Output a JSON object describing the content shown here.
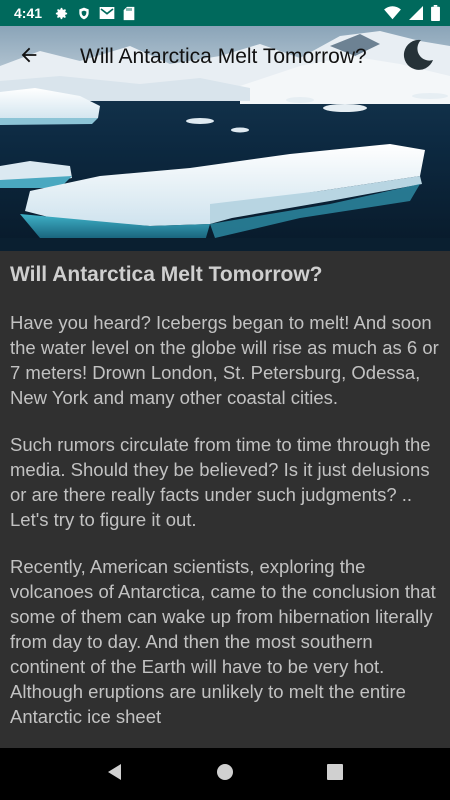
{
  "status_bar": {
    "time": "4:41",
    "icons_left": [
      "gear-icon",
      "shield-icon",
      "mail-icon",
      "sd-card-icon"
    ],
    "icons_right": [
      "wifi-icon",
      "signal-icon",
      "battery-icon"
    ],
    "background": "#00695c"
  },
  "toolbar": {
    "title": "Will Antarctica Melt Tomorrow?",
    "back_icon": "arrow-back-icon",
    "night_icon": "moon-icon"
  },
  "article": {
    "title": "Will Antarctica Melt Tomorrow?",
    "paragraphs": [
      "Have you heard? Icebergs began to melt! And soon the water level on the globe will rise as much as 6 or 7 meters! Drown London, St. Petersburg, Odessa, New York and many other coastal cities.",
      "Such rumors circulate from time to time through the media. Should they be believed? Is it just delusions or are there really facts under such judgments? .. Let's try to figure it out.",
      "Recently, American scientists, exploring the volcanoes of Antarctica, came to the conclusion that some of them can wake up from hibernation literally from day to day. And then the most southern continent of the Earth will have to be very hot. Although eruptions are unlikely to melt the entire Antarctic ice sheet"
    ]
  },
  "nav_bar": {
    "icons": [
      "back-triangle-icon",
      "home-circle-icon",
      "recents-square-icon"
    ]
  },
  "colors": {
    "background": "#303030",
    "text": "#c2c2c2"
  }
}
